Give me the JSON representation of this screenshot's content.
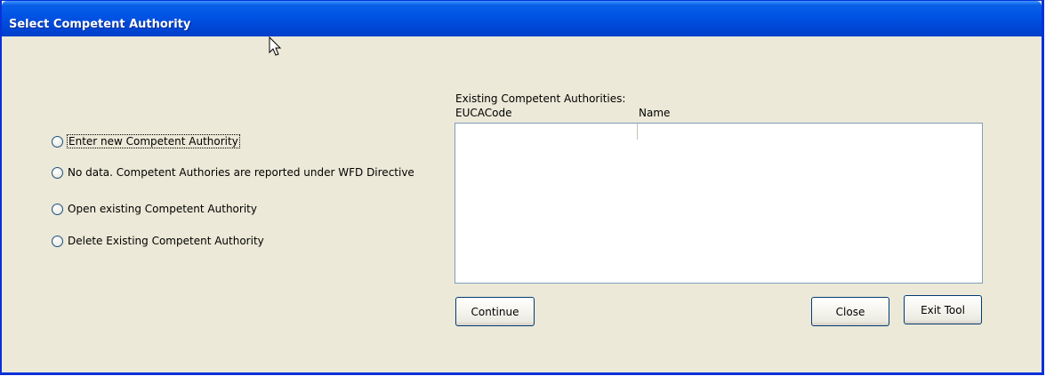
{
  "window": {
    "title": "Select Competent Authority"
  },
  "options": [
    {
      "label": "Enter new Competent Authority",
      "selected": false,
      "focused": true
    },
    {
      "label": "No data. Competent Authories are reported under WFD Directive",
      "selected": false,
      "focused": false
    },
    {
      "label": "Open existing Competent Authority",
      "selected": false,
      "focused": false
    },
    {
      "label": "Delete Existing Competent Authority",
      "selected": false,
      "focused": false
    }
  ],
  "list": {
    "heading": "Existing Competent Authorities:",
    "columns": [
      "EUCACode",
      "Name"
    ],
    "rows": []
  },
  "buttons": {
    "continue": "Continue",
    "close": "Close",
    "exit": "Exit Tool"
  },
  "colors": {
    "titlebar": "#0055e5",
    "window_bg": "#ece9d8",
    "border": "#0831d9"
  }
}
